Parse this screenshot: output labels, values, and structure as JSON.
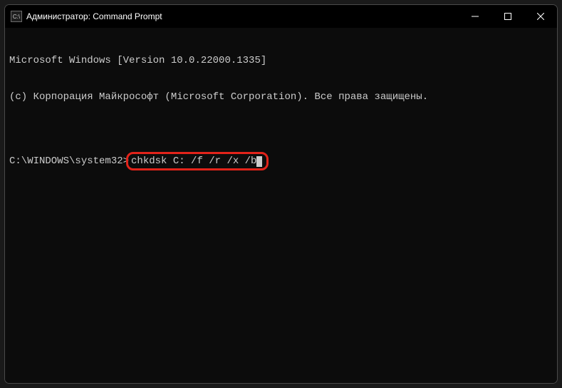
{
  "window": {
    "title": "Администратор: Command Prompt",
    "icon_label": "cmd"
  },
  "terminal": {
    "line1": "Microsoft Windows [Version 10.0.22000.1335]",
    "line2": "(c) Корпорация Майкрософт (Microsoft Corporation). Все права защищены.",
    "blank": "",
    "prompt_path": "C:\\WINDOWS\\system32>",
    "command": "chkdsk C: /f /r /x /b"
  }
}
